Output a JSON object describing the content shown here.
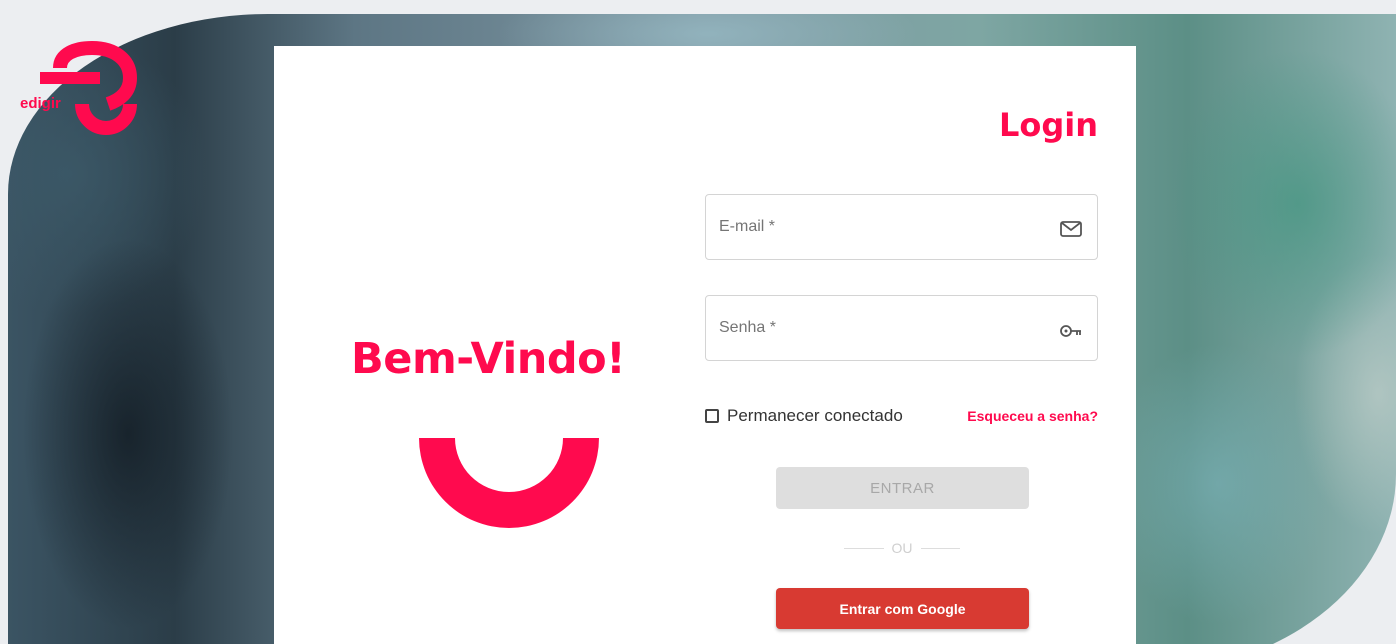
{
  "brand": {
    "name": "edigir",
    "color": "#ff0a4e"
  },
  "welcome": {
    "heading": "Bem-Vindo!"
  },
  "login": {
    "title": "Login",
    "email_placeholder": "E-mail *",
    "email_icon": "mail-icon",
    "password_placeholder": "Senha *",
    "password_icon": "key-icon",
    "remember_label": "Permanecer conectado",
    "remember_checked": false,
    "forgot_label": "Esqueceu a senha?",
    "submit_label": "ENTRAR",
    "divider_label": "OU",
    "google_label": "Entrar com Google",
    "google_color": "#d83a32"
  }
}
